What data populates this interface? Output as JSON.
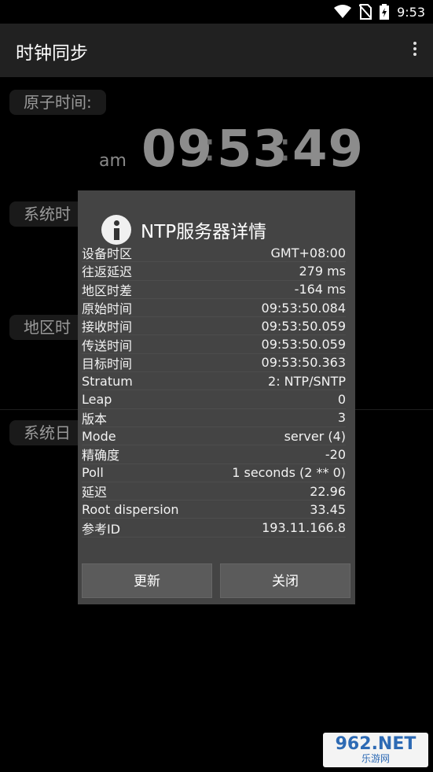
{
  "statusbar": {
    "time": "9:53"
  },
  "appbar": {
    "title": "时钟同步"
  },
  "background": {
    "atomic_label": "原子时间:",
    "system_label": "系统时",
    "region_label": "地区时",
    "date_label": "系统日",
    "clock": {
      "ampm": "am",
      "hours": "09",
      "minutes": "53",
      "seconds": "49",
      "sep": ":"
    }
  },
  "dialog": {
    "title": "NTP服务器详情",
    "rows": [
      {
        "label": "设备时区",
        "value": "GMT+08:00"
      },
      {
        "label": "往返延迟",
        "value": "279 ms"
      },
      {
        "label": "地区时差",
        "value": "-164 ms"
      },
      {
        "label": "原始时间",
        "value": "09:53:50.084"
      },
      {
        "label": "接收时间",
        "value": "09:53:50.059"
      },
      {
        "label": "传送时间",
        "value": "09:53:50.059"
      },
      {
        "label": "目标时间",
        "value": "09:53:50.363"
      },
      {
        "label": "Stratum",
        "value": "2: NTP/SNTP"
      },
      {
        "label": "Leap",
        "value": "0"
      },
      {
        "label": "版本",
        "value": "3"
      },
      {
        "label": "Mode",
        "value": "server (4)"
      },
      {
        "label": "精确度",
        "value": "-20"
      },
      {
        "label": "Poll",
        "value": "1 seconds (2 ** 0)"
      },
      {
        "label": "延迟",
        "value": "22.96"
      },
      {
        "label": "Root dispersion",
        "value": "33.45"
      },
      {
        "label": "参考ID",
        "value": "193.11.166.8"
      }
    ],
    "update_button": "更新",
    "close_button": "关闭"
  },
  "watermark": {
    "brand_num": "962",
    "brand_suffix": ".NET",
    "sub": "乐游网"
  },
  "icons": [
    "wifi-icon",
    "no-sim-icon",
    "battery-icon",
    "overflow-menu-icon",
    "info-icon"
  ]
}
